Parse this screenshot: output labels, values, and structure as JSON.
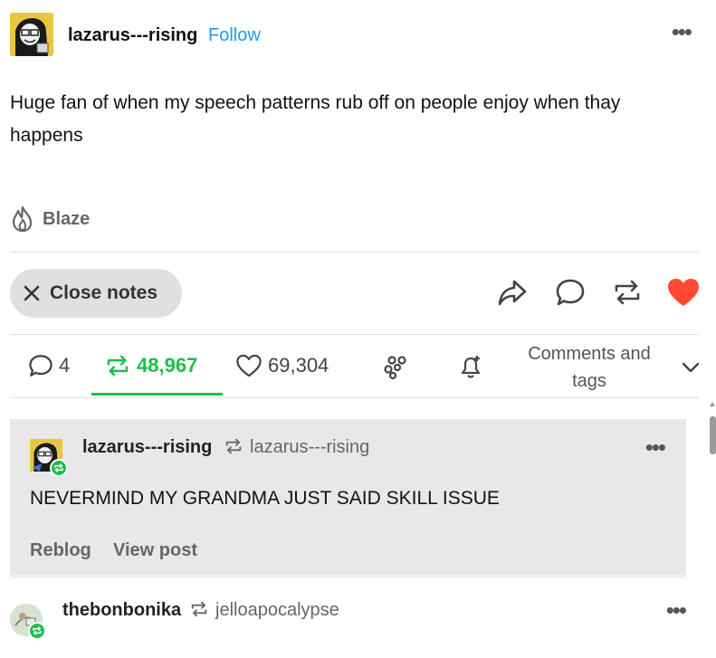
{
  "post": {
    "blog_name": "lazarus---rising",
    "follow_label": "Follow",
    "text": "Huge fan of when my speech patterns rub off on people enjoy when thay happens",
    "blaze_label": "Blaze",
    "close_notes_label": "Close notes",
    "icons": [
      "share-icon",
      "reply-icon",
      "reblog-icon",
      "like-icon"
    ],
    "like_color": "#ff4930"
  },
  "notes": {
    "replies": "4",
    "reblogs": "48,967",
    "likes": "69,304",
    "comments_tags_line1": "Comments and",
    "comments_tags_line2": "tags",
    "accent": "#1bbf4b"
  },
  "reblog_card": {
    "blog_name": "lazarus---rising",
    "source": "lazarus---rising",
    "text": "NEVERMIND MY GRANDMA JUST SAID SKILL ISSUE",
    "reblog_label": "Reblog",
    "view_post_label": "View post"
  },
  "next_post": {
    "blog_name": "thebonbonika",
    "source": "jelloapocalypse"
  }
}
